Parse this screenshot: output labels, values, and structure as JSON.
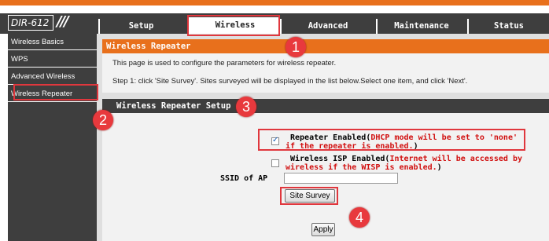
{
  "brand": {
    "logo": "DIR-612",
    "slashes": "///"
  },
  "tabs": [
    {
      "label": "Setup"
    },
    {
      "label": "Wireless"
    },
    {
      "label": "Advanced"
    },
    {
      "label": "Maintenance"
    },
    {
      "label": "Status"
    }
  ],
  "sidebar": {
    "items": [
      {
        "label": "Wireless Basics"
      },
      {
        "label": "WPS"
      },
      {
        "label": "Advanced Wireless"
      },
      {
        "label": "Wireless Repeater"
      }
    ]
  },
  "repeater": {
    "title": "Wireless Repeater",
    "desc1": "This page is used to configure the parameters for wireless repeater.",
    "desc2": "Step 1: click 'Site Survey'. Sites surveyed will be displayed in the list below.Select one item, and click 'Next'."
  },
  "setup": {
    "title": "Wireless Repeater Setup",
    "repeater_enabled": {
      "checked": true,
      "label": "Repeater Enabled(",
      "note": "DHCP mode will be set to 'none' if the repeater is enabled.",
      "close": ")"
    },
    "wisp_enabled": {
      "checked": false,
      "label": "Wireless ISP Enabled(",
      "note": "Internet will be accessed by wireless if the WISP is enabled.",
      "close": ")"
    },
    "ssid_label": "SSID of AP",
    "ssid_value": "",
    "site_survey_label": "Site Survey",
    "apply_label": "Apply"
  },
  "markers": [
    "1",
    "2",
    "3",
    "4"
  ],
  "colors": {
    "accent": "#e8701c",
    "dark": "#3e3e3e",
    "highlight": "#e0373d",
    "note_red": "#d11010"
  }
}
